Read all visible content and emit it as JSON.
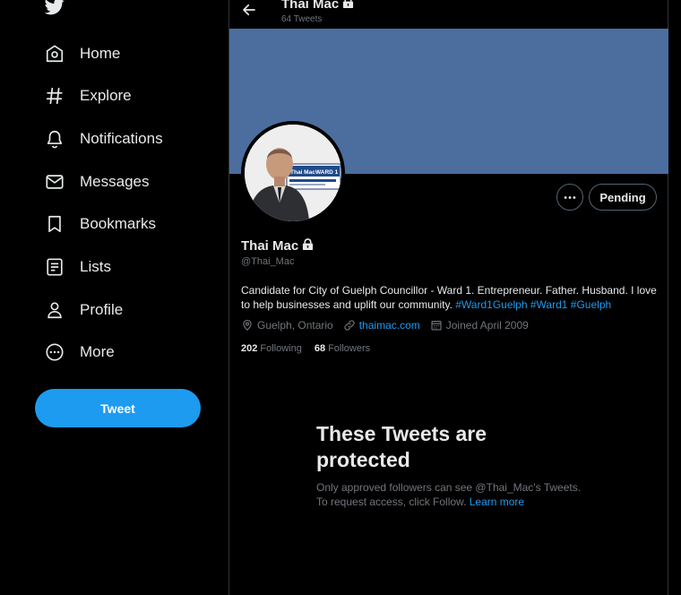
{
  "sidebar": {
    "items": [
      {
        "label": "Home"
      },
      {
        "label": "Explore"
      },
      {
        "label": "Notifications"
      },
      {
        "label": "Messages"
      },
      {
        "label": "Bookmarks"
      },
      {
        "label": "Lists"
      },
      {
        "label": "Profile"
      },
      {
        "label": "More"
      }
    ],
    "tweet_label": "Tweet"
  },
  "header": {
    "name": "Thai Mac",
    "tweet_count": "64 Tweets"
  },
  "profile": {
    "name": "Thai Mac",
    "handle": "@Thai_Mac",
    "avatar_sign_text": "Thai Mac",
    "avatar_sign_ward": "WARD 1",
    "bio_text": "Candidate for City of Guelph Councillor - Ward 1. Entrepreneur. Father. Husband. I love to help businesses and uplift our community. ",
    "hashtags": [
      "#Ward1Guelph",
      "#Ward1",
      "#Guelph"
    ],
    "location": "Guelph, Ontario",
    "website": "thaimac.com",
    "joined": "Joined April 2009",
    "following_count": "202",
    "following_label": "Following",
    "followers_count": "68",
    "followers_label": "Followers",
    "pending_label": "Pending"
  },
  "protected": {
    "title": "These Tweets are protected",
    "text": "Only approved followers can see @Thai_Mac's Tweets. To request access, click Follow. ",
    "learn_more": "Learn more"
  },
  "colors": {
    "accent": "#1d9bf0",
    "banner": "#4b6e9f",
    "secondary_text": "#71767b"
  }
}
